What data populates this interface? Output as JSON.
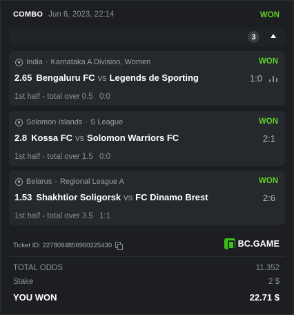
{
  "ticket": {
    "type": "COMBO",
    "date": "Jun 6, 2023, 22:14",
    "status": "WON",
    "selections_count": "3",
    "id_label": "Ticket ID:",
    "id_value": "2278094856960225430"
  },
  "brand": {
    "name": "BC.GAME",
    "color": "#3bc117"
  },
  "bets": [
    {
      "country": "India",
      "league": "Karnataka A Division, Women",
      "status": "WON",
      "odds": "2.65",
      "home": "Bengaluru FC",
      "vs": "vs",
      "away": "Legends de Sporting",
      "score": "1:0",
      "market": "1st half - total over 0.5",
      "market_score": "0:0",
      "icons": [
        "soccer-ball-icon",
        "stats-icon"
      ]
    },
    {
      "country": "Solomon Islands",
      "league": "S League",
      "status": "WON",
      "odds": "2.8",
      "home": "Kossa FC",
      "vs": "vs",
      "away": "Solomon Warriors FC",
      "score": "2:1",
      "market": "1st half - total over 1.5",
      "market_score": "0:0"
    },
    {
      "country": "Belarus",
      "league": "Regional League A",
      "status": "WON",
      "odds": "1.53",
      "home": "Shakhtior Soligorsk",
      "vs": "vs",
      "away": "FC Dinamo Brest",
      "score": "2:6",
      "market": "1st half - total over 3.5",
      "market_score": "1:1"
    }
  ],
  "summary": {
    "total_odds_label": "TOTAL ODDS",
    "total_odds_value": "11.352",
    "stake_label": "Stake",
    "stake_value": "2 $",
    "won_label": "YOU WON",
    "won_value": "22.71 $"
  },
  "colors": {
    "won": "#5ed127",
    "background": "#1c1e22",
    "card": "#25282c"
  }
}
